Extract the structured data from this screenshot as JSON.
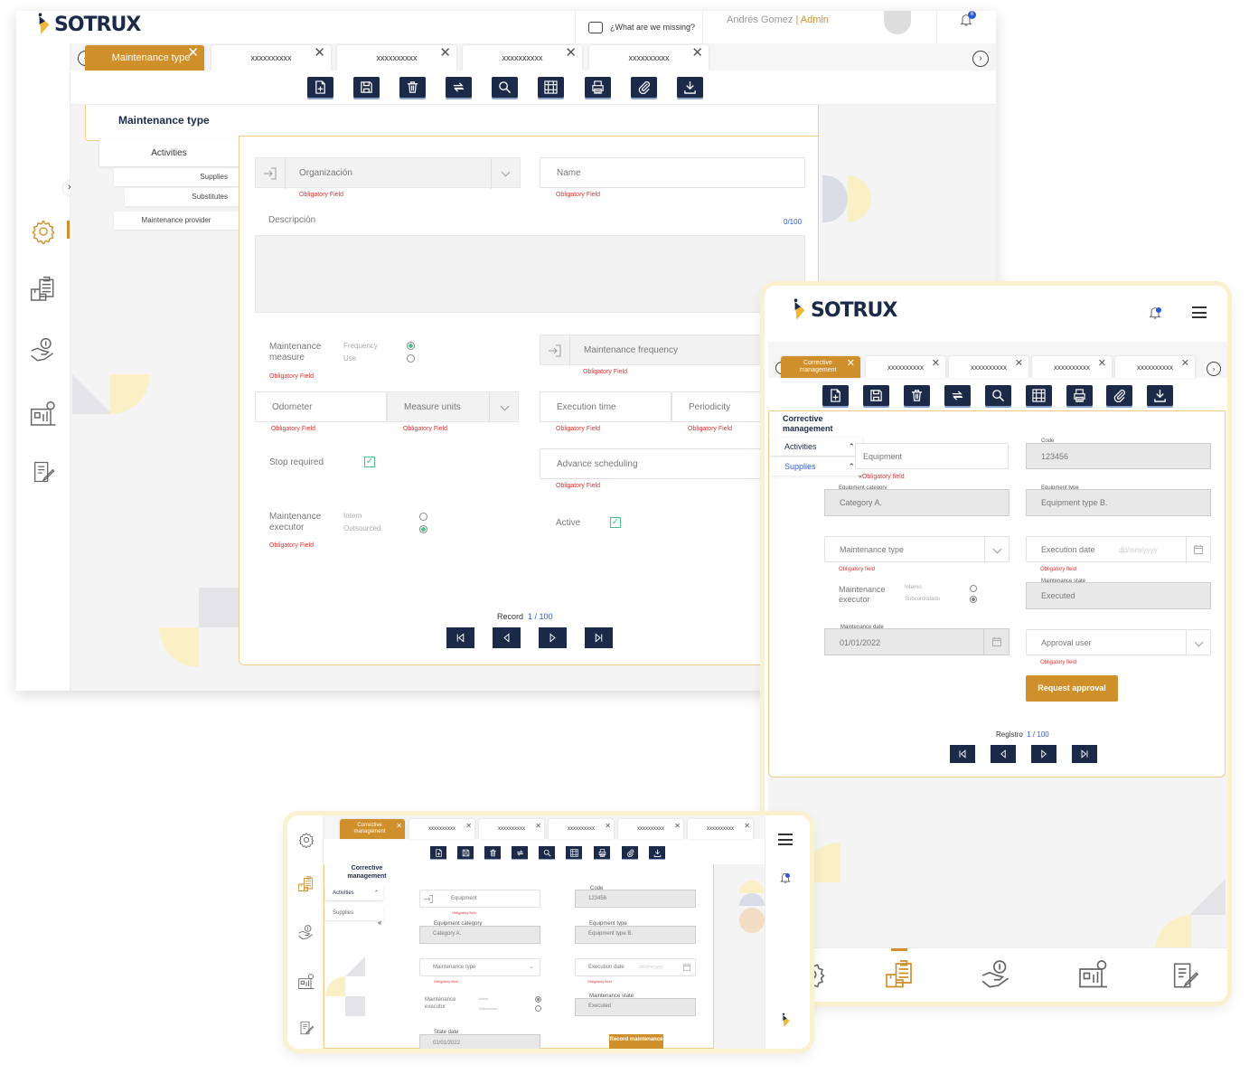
{
  "brand": "SOTRUX",
  "desktop": {
    "help_text": "¿What are we missing?",
    "user_name": "Andrés Gomez",
    "user_role": "Admin",
    "notification_count": "6",
    "tabs": [
      "Maintenance type",
      "xxxxxxxxxx",
      "xxxxxxxxxx",
      "xxxxxxxxxx",
      "xxxxxxxxxx"
    ],
    "page_title": "Maintenance type",
    "side_menu": [
      "Activities",
      "Supplies",
      "Substitutes",
      "Maintenance provider"
    ],
    "organizacion_placeholder": "Organización",
    "name_placeholder": "Name",
    "required": "Obligatory Field",
    "description_label": "Descripción",
    "description_counter": "0/100",
    "maintenance_measure": "Maintenance measure",
    "frequency": "Frequency",
    "use": "Use",
    "maintenance_frequency": "Maintenance frequency",
    "odometer": "Odometer",
    "measure_units": "Measure units",
    "execution_time": "Execution time",
    "periodicity": "Periodicity",
    "stop_required": "Stop required",
    "advance_scheduling": "Advance scheduling",
    "maintenance_executor": "Maintenance executor",
    "intern": "Intern",
    "outsourced": "Outsourced",
    "active": "Active",
    "record_label": "Record",
    "record_value": "1 / 100"
  },
  "tablet": {
    "tabs": [
      "Corrective management",
      "xxxxxxxxxx",
      "xxxxxxxxxx",
      "xxxxxxxxxx",
      "xxxxxxxxxx"
    ],
    "page_title": "Corrective management",
    "side_menu": [
      "Activities",
      "Supplies"
    ],
    "equipment": "Equipment",
    "required": "Obligatory field",
    "code_label": "Code",
    "code_value": "123456",
    "equipment_category_label": "Equipment category",
    "equipment_category_value": "Category A.",
    "equipment_type_label": "Equipment type",
    "equipment_type_value": "Equipment type B.",
    "maintenance_type": "Maintenance type",
    "execution_date": "Execution date",
    "date_placeholder": "dd/mm/yyyy",
    "maintenance_executor": "Maintenance executor",
    "interno": "Interno",
    "subcontratado": "Subcontratado",
    "maintenance_state_label": "Maintenance state",
    "maintenance_state_value": "Executed",
    "maintenance_date_label": "Maintenance date",
    "maintenance_date_value": "01/01/2022",
    "approval_user": "Approval user",
    "request_approval": "Request approval",
    "registro_label": "Registro",
    "registro_value": "1 / 100"
  },
  "small": {
    "tabs": [
      "Corrective management",
      "xxxxxxxxxx",
      "xxxxxxxxxx",
      "xxxxxxxxxx",
      "xxxxxxxxxx",
      "xxxxxxxxxx"
    ],
    "page_title": "Corrective management",
    "side_menu": [
      "Activities",
      "Supplies"
    ],
    "equipment": "Equipment",
    "required": "Obligatory field",
    "code_label": "Code",
    "code_value": "123456",
    "equipment_category_label": "Equipment category",
    "equipment_category_value": "Category A.",
    "equipment_type_label": "Equipment type",
    "equipment_type_value": "Equipment type B.",
    "maintenance_type": "Maintenance type",
    "execution_date": "Execution date",
    "date_placeholder": "dd/mm/yyyy",
    "maintenance_executor": "Maintenance executor",
    "intern": "Intern",
    "outsourced": "Outsourced",
    "maintenance_state_label": "Maintenance state",
    "maintenance_state_value": "Executed",
    "state_date_label": "State date",
    "state_date_value": "01/01/2022",
    "record_maintenance": "Record maintenance"
  },
  "colors": {
    "accent": "#cf8f2a",
    "navy": "#1c2a4a",
    "required": "#dd3333",
    "green": "#4bbf8c"
  }
}
